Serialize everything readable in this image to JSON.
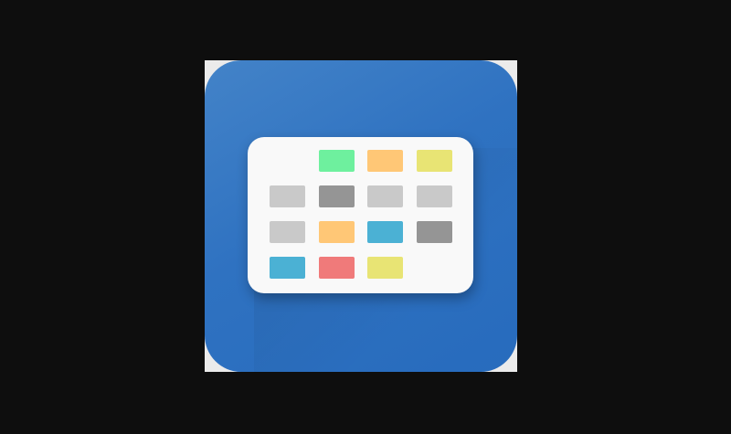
{
  "icon": {
    "name": "calendar-app-icon",
    "background_color": "#2f72c1",
    "card_color": "#f9f9f9"
  },
  "grid": {
    "columns": 4,
    "rows": [
      [
        null,
        "#6ef09e",
        "#ffc776",
        "#e8e474"
      ],
      [
        "#c9c9c9",
        "#959595",
        "#c9c9c9",
        "#c9c9c9"
      ],
      [
        "#c9c9c9",
        "#ffc776",
        "#4bb1d4",
        "#959595"
      ],
      [
        "#4bb1d4",
        "#f07a7a",
        "#e8e474",
        null
      ]
    ]
  }
}
